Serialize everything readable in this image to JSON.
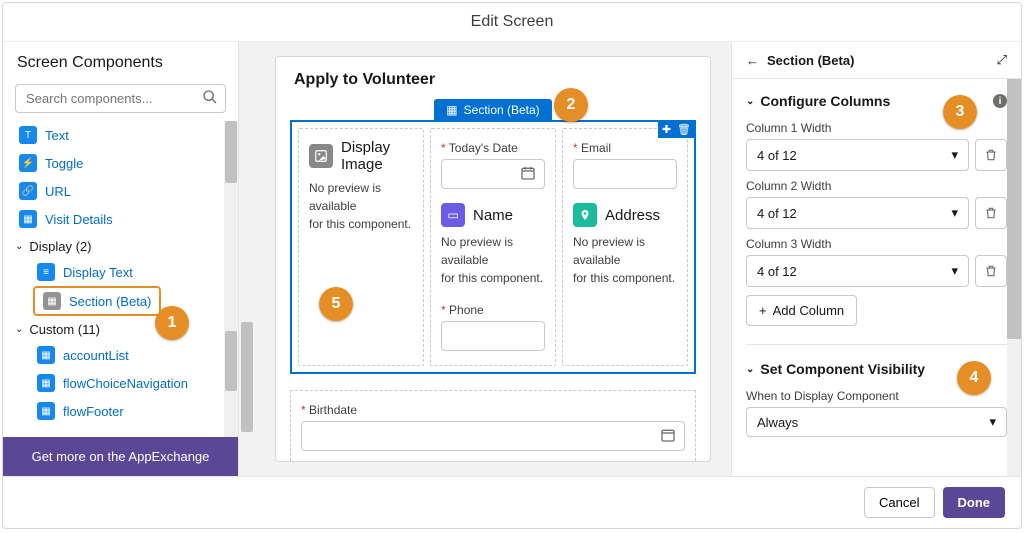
{
  "header": {
    "title": "Edit Screen"
  },
  "left": {
    "heading": "Screen Components",
    "search_placeholder": "Search components...",
    "items_top": [
      {
        "key": "text",
        "label": "Text"
      },
      {
        "key": "toggle",
        "label": "Toggle"
      },
      {
        "key": "url",
        "label": "URL"
      },
      {
        "key": "visit",
        "label": "Visit Details"
      }
    ],
    "group_display": "Display (2)",
    "display_items": [
      {
        "key": "display-text",
        "label": "Display Text"
      },
      {
        "key": "section",
        "label": "Section (Beta)"
      }
    ],
    "group_custom": "Custom (11)",
    "custom_items": [
      {
        "label": "accountList"
      },
      {
        "label": "flowChoiceNavigation"
      },
      {
        "label": "flowFooter"
      }
    ],
    "appexchange": "Get more on the AppExchange"
  },
  "canvas": {
    "title": "Apply to Volunteer",
    "section_label": "Section (Beta)",
    "col1": {
      "title": "Display Image",
      "msg1": "No preview is available",
      "msg2": "for this component."
    },
    "col2": {
      "date_label": "Today's Date",
      "name_title": "Name",
      "name_msg1": "No preview is available",
      "name_msg2": "for this component.",
      "phone_label": "Phone"
    },
    "col3": {
      "email_label": "Email",
      "addr_title": "Address",
      "addr_msg1": "No preview is available",
      "addr_msg2": "for this component."
    },
    "below": {
      "birthdate_label": "Birthdate"
    }
  },
  "right": {
    "title": "Section (Beta)",
    "configure": "Configure Columns",
    "col1_label": "Column 1 Width",
    "col2_label": "Column 2 Width",
    "col3_label": "Column 3 Width",
    "width_value": "4 of 12",
    "add_column": "Add Column",
    "visibility": "Set Component Visibility",
    "when_label": "When to Display Component",
    "when_value": "Always"
  },
  "footer": {
    "cancel": "Cancel",
    "done": "Done"
  },
  "callouts": {
    "1": "1",
    "2": "2",
    "3": "3",
    "4": "4",
    "5": "5"
  }
}
